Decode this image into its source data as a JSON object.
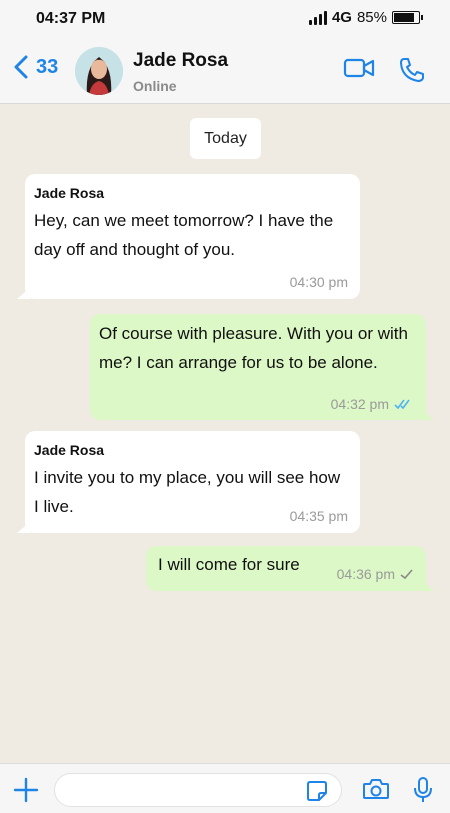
{
  "status_bar": {
    "time": "04:37 PM",
    "network": "4G",
    "battery": "85%",
    "battery_level": 0.85
  },
  "header": {
    "back_count": "33",
    "contact_name": "Jade Rosa",
    "contact_status": "Online"
  },
  "chat": {
    "date_chip": "Today",
    "messages": [
      {
        "direction": "incoming",
        "sender": "Jade Rosa",
        "text": " Hey, can we meet tomorrow? I have the day off and thought of you.",
        "time": "04:30 pm"
      },
      {
        "direction": "outgoing",
        "text": " Of course with pleasure. With you or with me? I can arrange for us to be alone.",
        "time": "04:32 pm",
        "receipt": "read"
      },
      {
        "direction": "incoming",
        "sender": "Jade Rosa",
        "text": " I invite you to my place, you will see how I live.",
        "time": "04:35 pm"
      },
      {
        "direction": "outgoing",
        "text": "I will come for sure",
        "time": "04:36 pm",
        "receipt": "delivered"
      }
    ]
  },
  "input_bar": {
    "placeholder": "",
    "value": ""
  },
  "colors": {
    "accent": "#1f84e8",
    "outgoing_bubble": "#dcf8c6",
    "incoming_bubble": "#ffffff",
    "chat_background": "#efeae2",
    "read_tick": "#4fb4f0",
    "delivered_tick": "#8a8a8a"
  },
  "icons": [
    "back-chevron-icon",
    "video-call-icon",
    "phone-call-icon",
    "plus-icon",
    "sticker-icon",
    "camera-icon",
    "microphone-icon"
  ]
}
